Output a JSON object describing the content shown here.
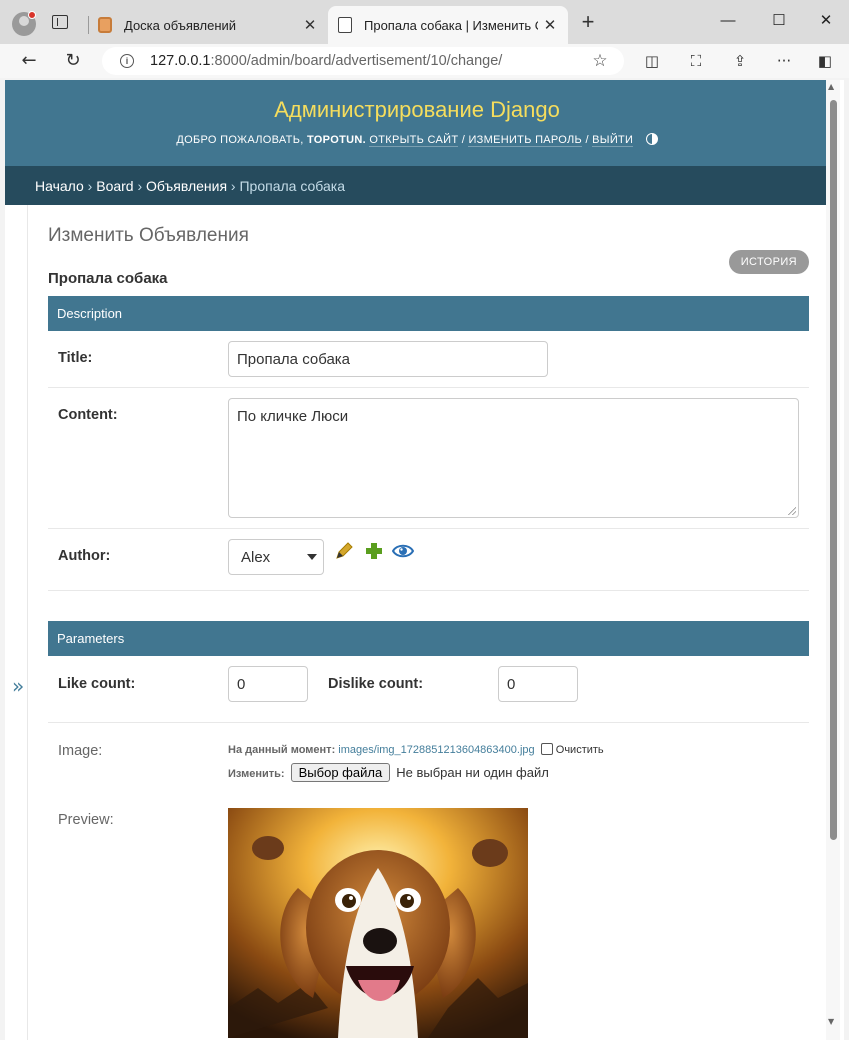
{
  "browser": {
    "tabs": [
      {
        "title": "Доска объявлений",
        "active": false
      },
      {
        "title": "Пропала собака | Изменить Объ",
        "active": true
      }
    ],
    "url_host": "127.0.0.1",
    "url_rest": ":8000/admin/board/advertisement/10/change/"
  },
  "header": {
    "branding": "Администрирование Django",
    "welcome": "ДОБРО ПОЖАЛОВАТЬ,",
    "username": "TOPOTUN.",
    "view_site": "ОТКРЫТЬ САЙТ",
    "change_password": "ИЗМЕНИТЬ ПАРОЛЬ",
    "logout": "ВЫЙТИ",
    "sep": "/"
  },
  "breadcrumbs": {
    "home": "Начало",
    "app": "Board",
    "model": "Объявления",
    "current": "Пропала собака",
    "sep": "›"
  },
  "nav_toggle": "»",
  "page": {
    "title": "Изменить Объявления",
    "object_title": "Пропала собака",
    "history_button": "ИСТОРИЯ"
  },
  "fieldsets": {
    "description": {
      "caption": "Description",
      "title_label": "Title:",
      "title_value": "Пропала собака",
      "content_label": "Content:",
      "content_value": "По кличке Люси",
      "author_label": "Author:",
      "author_value": "Alex"
    },
    "parameters": {
      "caption": "Parameters",
      "like_label": "Like count:",
      "like_value": "0",
      "dislike_label": "Dislike count:",
      "dislike_value": "0",
      "image_label": "Image:",
      "current_label": "На данный момент:",
      "current_file": "images/img_1728851213604863400.jpg",
      "clear_label": "Очистить",
      "change_label": "Изменить:",
      "choose_file_button": "Выбор файла",
      "no_file_text": "Не выбран ни один файл",
      "preview_label": "Preview:"
    }
  },
  "icons": {
    "edit": "pencil-icon",
    "add": "plus-icon",
    "view": "eye-icon"
  },
  "colors": {
    "header_bg": "#417690",
    "branding": "#f5dd5d",
    "breadcrumbs_bg": "#264b5d",
    "module_caption_bg": "#417690",
    "link": "#447e9b"
  }
}
